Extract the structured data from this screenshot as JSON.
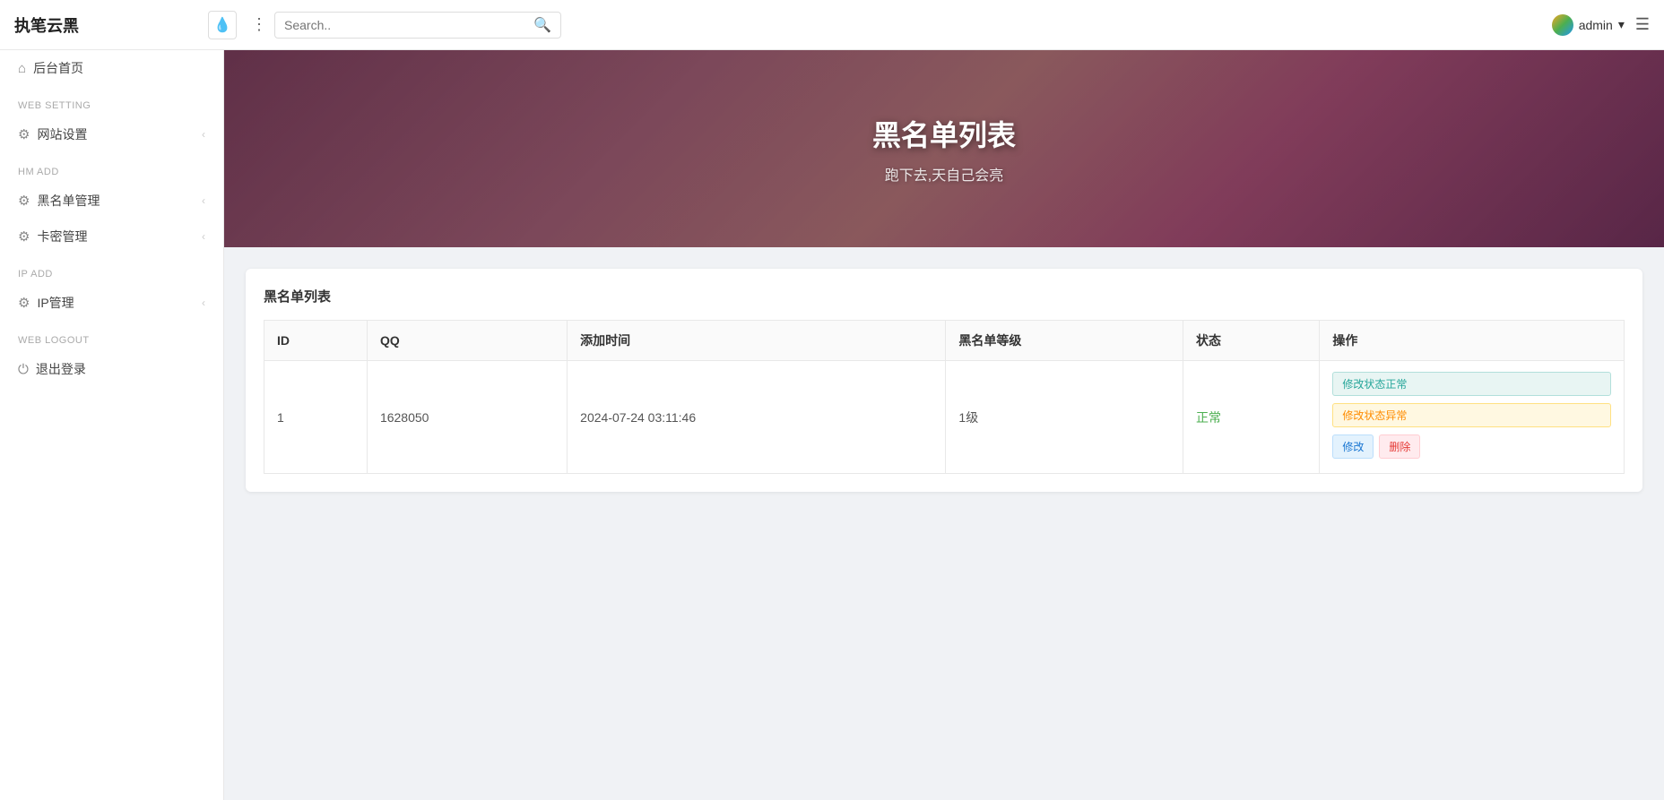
{
  "navbar": {
    "brand": "执笔云黑",
    "water_icon": "💧",
    "search_placeholder": "Search..",
    "search_icon": "🔍",
    "user_name": "admin",
    "user_chevron": "▾",
    "menu_icon": "☰"
  },
  "sidebar": {
    "sections": [
      {
        "items": [
          {
            "icon": "⌂",
            "label": "后台首页",
            "has_arrow": false
          }
        ]
      },
      {
        "label": "WEB SETTING",
        "items": [
          {
            "icon": "⚙",
            "label": "网站设置",
            "has_arrow": true
          }
        ]
      },
      {
        "label": "HM ADD",
        "items": [
          {
            "icon": "⚙",
            "label": "黑名单管理",
            "has_arrow": true
          },
          {
            "icon": "⚙",
            "label": "卡密管理",
            "has_arrow": true
          }
        ]
      },
      {
        "label": "IP ADD",
        "items": [
          {
            "icon": "⚙",
            "label": "IP管理",
            "has_arrow": true
          }
        ]
      },
      {
        "label": "WEB LOGOUT",
        "items": [
          {
            "icon": "⏻",
            "label": "退出登录",
            "has_arrow": false
          }
        ]
      }
    ]
  },
  "banner": {
    "title": "黑名单列表",
    "subtitle": "跑下去,天自己会亮"
  },
  "table": {
    "card_title": "黑名单列表",
    "columns": [
      "ID",
      "QQ",
      "添加时间",
      "黑名单等级",
      "状态",
      "操作"
    ],
    "rows": [
      {
        "id": "1",
        "qq": "1628050",
        "add_time": "2024-07-24 03:11:46",
        "level": "1级",
        "status": "正常",
        "status_class": "normal",
        "actions": [
          "修改状态正常",
          "修改状态异常",
          "修改",
          "删除"
        ]
      }
    ]
  }
}
